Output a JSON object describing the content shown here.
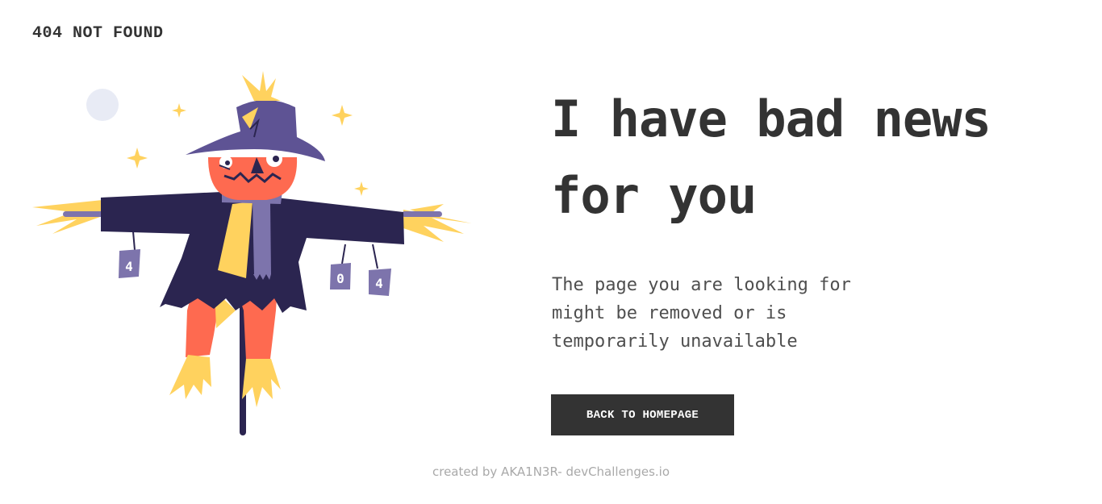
{
  "header": {
    "brand": "404 NOT FOUND"
  },
  "main": {
    "headline_line1": "I have bad news",
    "headline_line2": "for you",
    "message_line1": "The page you are looking for",
    "message_line2": "might be removed or is",
    "message_line3": "temporarily unavailable",
    "cta_label": "BACK TO HOMEPAGE"
  },
  "illustration": {
    "subject": "scarecrow-illustration",
    "cans": [
      "4",
      "0",
      "4"
    ]
  },
  "footer": {
    "credit": "created by AKA1N3R- devChallenges.io"
  },
  "colors": {
    "text": "#333333",
    "button_bg": "#333333",
    "button_text": "#ffffff",
    "footer_text": "#a9a9a9",
    "coat": "#2b2550",
    "hat": "#5e5394",
    "face": "#fe6a50",
    "straw": "#ffd25e",
    "can": "#7d74ac"
  }
}
